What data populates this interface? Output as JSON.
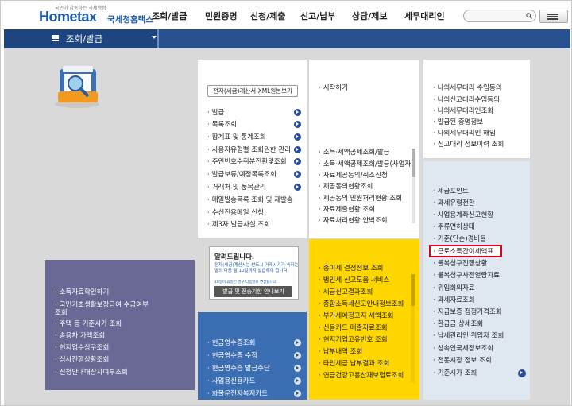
{
  "header": {
    "logo_small": "국민이 감동하는 국세행정",
    "logo_brand": "Hometax",
    "logo_sub": "국세청홈택스",
    "nav": [
      "조회/발급",
      "민원증명",
      "신청/제출",
      "신고/납부",
      "상담/제보",
      "세무대리인"
    ],
    "search_placeholder": ""
  },
  "navbar": {
    "title": "조회/발급"
  },
  "panels": {
    "p1": {
      "toggle": "전자(세금)계산서 XML원본보기",
      "items": [
        "발급",
        "목록조회",
        "합계표 및 통계조회",
        "사용자유형별 조회권한 관리",
        "주민번호수취분전환및조회",
        "발급보류/예정목록조회",
        "거래처 및 품목관리",
        "메일발송목록 조회 및 재발송",
        "수신전용메일 신청",
        "제3자 발급사실 조회"
      ]
    },
    "notice": {
      "title": "알려드립니다.",
      "text": "전자(세금)계산서는 반드시 거래시기가 속하는 달의 다음 달 10일까지 발급해야 합니다.",
      "note": "10일이 휴일인 경우 다음날로 연장됩니다.",
      "button": "발급 및 전송기한 안내보기"
    },
    "p2": {
      "top": [
        "시작하기"
      ],
      "items": [
        "소득·세액공제조회/발급",
        "소득·세액공제조회/발급(사업자)",
        "자료제공동의/취소신청",
        "제공동의현황조회",
        "제공동의 민원처리현황 조회",
        "자료제출현황 조회",
        "자료처리현황 안벽조회"
      ]
    },
    "p3": {
      "items": [
        "나의세무대리 수임동의",
        "나의신고대리수임동의",
        "나의세무대리인조회",
        "발급된 증명정보",
        "나의세무대리인 해임",
        "신고대리 정보이력 조회"
      ]
    },
    "p4": {
      "items": [
        "세금포인트",
        "과세유형전환",
        "사업용계좌신고현황",
        "주류면허상태",
        "기준(단순)경비율",
        "근로소득간이세액표",
        "불복청구진행상황",
        "불복청구사전열람자료",
        "위임회의자료",
        "과세자료조회",
        "지급보증 정정가격조회",
        "환급금 상세조회",
        "납세관리인 위임자 조회",
        "상속인국세정보조회",
        "전통시장 정보 조회",
        "기준시가 조회"
      ]
    },
    "p5": {
      "items": [
        "종이세 결정정보 조회",
        "법인세 신고도움 서비스",
        "세금신고결과조회",
        "종합소득세신고안내정보조회",
        "부가세예정고지 세액조회",
        "신용카드 매출자료조회",
        "현지기업고유번호 조회",
        "납부내역 조회",
        "타인세금 납부결과 조회",
        "연금건강고용산재보험료조회"
      ]
    },
    "p6": {
      "items": [
        "소득자료확인하기",
        "국민기초생활보장급여 수급여부 조회",
        "주택 등 기준시가 조회",
        "송용차 가액조회",
        "현지업수상구조회",
        "심사진행상황조회",
        "신청안내대상자여부조회"
      ]
    },
    "p7": {
      "items": [
        "현금영수증조회",
        "현금영수증 수정",
        "현금영수증 발급수단",
        "사업용신용카드",
        "화물운전자복지카드"
      ]
    }
  },
  "highlight": "근로소득간이세액표",
  "colors": {
    "navbar": "#27508f",
    "highlight": "#e0001a",
    "purple": "#6a6894",
    "blue": "#3c6eb4",
    "yellow": "#ffd600",
    "lightblue": "#dfe7f0"
  }
}
